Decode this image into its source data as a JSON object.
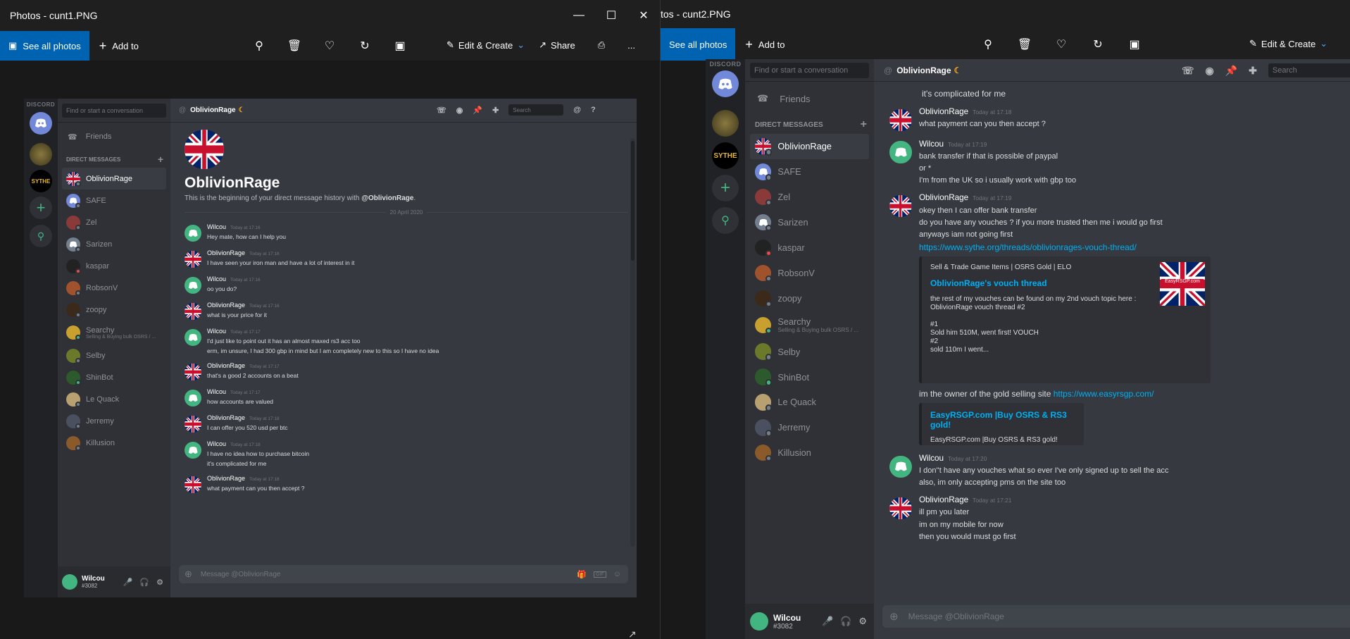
{
  "window1": {
    "title": "Photos - cunt1.PNG",
    "see_all": "See all photos",
    "add_to": "Add to",
    "edit_create": "Edit & Create",
    "share": "Share",
    "more": "..."
  },
  "window2": {
    "title": "tos - cunt2.PNG",
    "see_all": "See all photos",
    "add_to": "Add to",
    "edit_create": "Edit & Create"
  },
  "discord": {
    "brand": "DISCORD",
    "find_placeholder": "Find or start a conversation",
    "friends": "Friends",
    "direct_messages": "DIRECT MESSAGES",
    "channel_name": "OblivionRage",
    "search": "Search",
    "compose_placeholder": "Message @OblivionRage",
    "server_label_sythe": "SYTHE",
    "user": {
      "name": "Wilcou",
      "tag": "#3082"
    },
    "dms": [
      {
        "name": "OblivionRage",
        "sub": "",
        "av": "uk",
        "status": "o"
      },
      {
        "name": "SAFE",
        "sub": "",
        "av": "dc1",
        "status": "o"
      },
      {
        "name": "Zel",
        "sub": "",
        "av": "zel",
        "status": "o"
      },
      {
        "name": "Sarizen",
        "sub": "",
        "av": "dcg",
        "status": "o"
      },
      {
        "name": "kaspar",
        "sub": "",
        "av": "kas",
        "status": "r"
      },
      {
        "name": "RobsonV",
        "sub": "",
        "av": "rob",
        "status": "o"
      },
      {
        "name": "zoopy",
        "sub": "",
        "av": "zoo",
        "status": "o"
      },
      {
        "name": "Searchy",
        "sub": "Selling & Buying bulk OSRS / ...",
        "av": "sea",
        "status": "g"
      },
      {
        "name": "Selby",
        "sub": "",
        "av": "sel",
        "status": "o"
      },
      {
        "name": "ShinBot",
        "sub": "",
        "av": "shi",
        "status": "g"
      },
      {
        "name": "Le Quack",
        "sub": "",
        "av": "leq",
        "status": "o"
      },
      {
        "name": "Jerremy",
        "sub": "",
        "av": "jer",
        "status": "o"
      },
      {
        "name": "Killusion",
        "sub": "",
        "av": "kil",
        "status": "o"
      }
    ]
  },
  "chat1": {
    "intro_name": "OblivionRage",
    "intro_text": "This is the beginning of your direct message history with ",
    "intro_bold": "@OblivionRage",
    "intro_end": ".",
    "date_divider": "20 April 2020",
    "messages": [
      {
        "author": "Wilcou",
        "time": "Today at 17:16",
        "av": "dcgreen",
        "lines": [
          "Hey mate, how can I help you"
        ]
      },
      {
        "author": "OblivionRage",
        "time": "Today at 17:16",
        "av": "uk",
        "lines": [
          "I have seen your iron man and have a lot of interest in it"
        ]
      },
      {
        "author": "Wilcou",
        "time": "Today at 17:16",
        "av": "dcgreen",
        "lines": [
          "oo you do?"
        ]
      },
      {
        "author": "OblivionRage",
        "time": "Today at 17:16",
        "av": "uk",
        "lines": [
          "what is your price for it"
        ]
      },
      {
        "author": "Wilcou",
        "time": "Today at 17:17",
        "av": "dcgreen",
        "lines": [
          "I'd just like to point out it has an almost maxed rs3 acc too",
          "erm, im unsure, I had 300 gbp in mind but I am completely new to this so I have no idea"
        ]
      },
      {
        "author": "OblivionRage",
        "time": "Today at 17:17",
        "av": "uk",
        "lines": [
          "that's a good 2 accounts on a beat"
        ]
      },
      {
        "author": "Wilcou",
        "time": "Today at 17:17",
        "av": "dcgreen",
        "lines": [
          "how accounts are valued"
        ]
      },
      {
        "author": "OblivionRage",
        "time": "Today at 17:18",
        "av": "uk",
        "lines": [
          "I can offer you 520 usd per btc"
        ]
      },
      {
        "author": "Wilcou",
        "time": "Today at 17:18",
        "av": "dcgreen",
        "lines": [
          "I have no idea how to purchase bitcoin",
          "it's complicated for me"
        ]
      },
      {
        "author": "OblivionRage",
        "time": "Today at 17:18",
        "av": "uk",
        "lines": [
          "what payment can you then accept ?"
        ]
      }
    ]
  },
  "chat2": {
    "top_line": "it's complicated for me",
    "m1": {
      "author": "OblivionRage",
      "time": "Today at 17:18",
      "lines": [
        "what payment can you then accept ?"
      ]
    },
    "m2": {
      "author": "Wilcou",
      "time": "Today at 17:19",
      "lines": [
        "bank transfer if that is possible of paypal",
        "or *",
        "I'm from the UK so i usually work with gbp too"
      ]
    },
    "m3": {
      "author": "OblivionRage",
      "time": "Today at 17:19",
      "lines": [
        "okey then I can offer bank transfer",
        "do you have any vouches ? if you more trusted then me i would go first",
        "anyways iam not going first"
      ],
      "link": "https://www.sythe.org/threads/oblivionrages-vouch-thread/"
    },
    "embed1": {
      "provider": "Sell & Trade Game Items | OSRS Gold | ELO",
      "title": "OblivionRage's vouch thread",
      "desc": [
        "the rest of my vouches can be found on my 2nd vouch topic here :",
        "OblivionRage vouch thread #2",
        "",
        "#1",
        "Sold him 510M, went first! VOUCH",
        "#2",
        "sold 110m I went..."
      ],
      "thumb_text": "EasyRSGP.com"
    },
    "owner_text": "im the owner of the gold selling site ",
    "owner_link": "https://www.easyrsgp.com/",
    "embed2": {
      "title": "EasyRSGP.com  |Buy OSRS & RS3 gold!",
      "desc": "EasyRSGP.com |Buy OSRS & RS3 gold!"
    },
    "m4": {
      "author": "Wilcou",
      "time": "Today at 17:20",
      "lines": [
        "I don''t have any vouches what so ever I've only signed up to sell the acc",
        "also, im only accepting pms on the site too"
      ]
    },
    "m5": {
      "author": "OblivionRage",
      "time": "Today at 17:21",
      "lines": [
        "ill pm you later",
        "im on my mobile for now",
        "then you would must go first"
      ]
    }
  },
  "colors": {
    "accent": "#0063b1",
    "discord_blurple": "#7289da",
    "link": "#00b0f4",
    "online": "#43b581"
  }
}
